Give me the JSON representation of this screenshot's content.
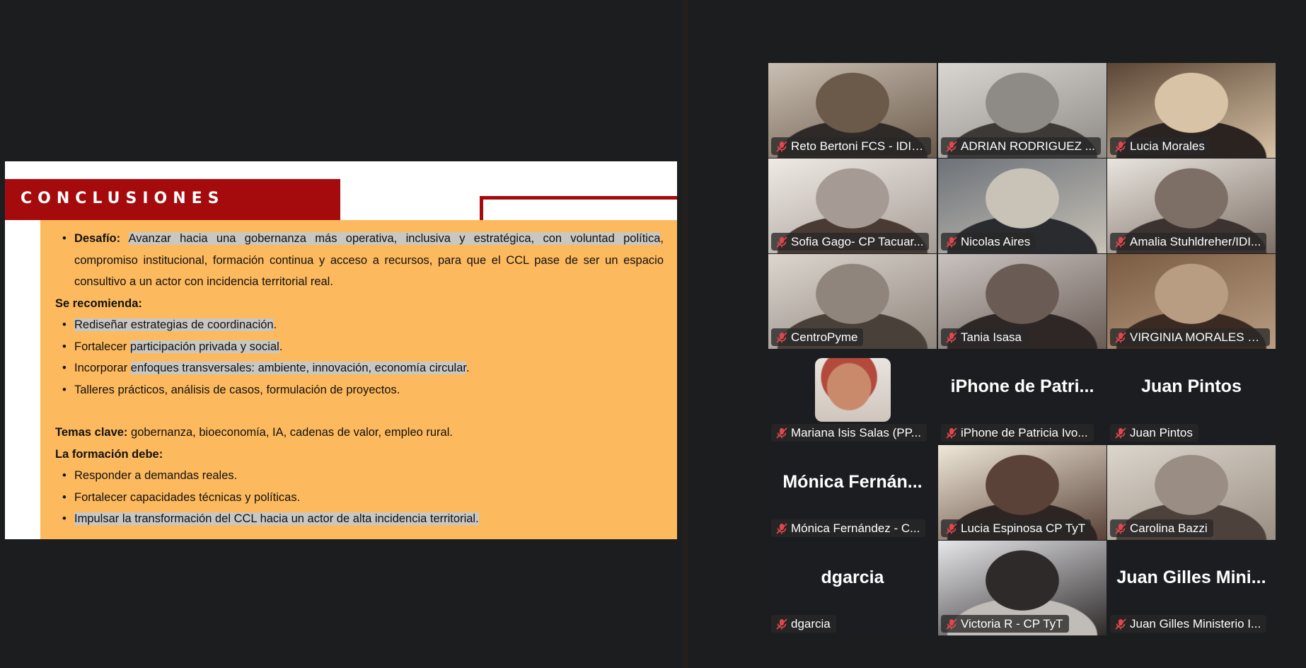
{
  "slide": {
    "title": "CONCLUSIONES",
    "desafio_label": "Desafío:",
    "desafio_hl": "Avanzar hacia una gobernanza más operativa, inclusiva y estratégica, con voluntad política",
    "desafio_rest": ", compromiso institucional, formación continua y acceso a recursos, para que el CCL pase de ser un espacio consultivo a un actor con incidencia territorial real.",
    "recomienda_heading": "Se recomienda:",
    "rec_1_hl": "Rediseñar estrategias de coordinación",
    "rec_1_end": ".",
    "rec_2_pre": "Fortalecer ",
    "rec_2_hl": "participación privada y social",
    "rec_2_end": ".",
    "rec_3_pre": "Incorporar ",
    "rec_3_hl": "enfoques transversales: ambiente, innovación, economía circular",
    "rec_3_end": ".",
    "rec_4": "Talleres prácticos, análisis de casos, formulación de proyectos.",
    "temas_label": "Temas clave:",
    "temas_text": " gobernanza, bioeconomía, IA, cadenas de valor, empleo rural.",
    "formacion_heading": "La formación debe:",
    "form_1": "Responder a demandas reales.",
    "form_2": "Fortalecer capacidades técnicas y políticas.",
    "form_3_hl": "Impulsar la transformación del CCL hacia un actor de alta incidencia territorial.",
    "bullet_char": "•"
  },
  "participants": [
    {
      "name": "Reto Bertoni FCS - IDIIS...",
      "video": true
    },
    {
      "name": "ADRIAN RODRIGUEZ ...",
      "video": true
    },
    {
      "name": "Lucia Morales",
      "video": true,
      "active_speaker": true
    },
    {
      "name": "Sofia Gago- CP Tacuar...",
      "video": true
    },
    {
      "name": "Nicolas Aires",
      "video": true
    },
    {
      "name": "Amalia Stuhldreher/IDI...",
      "video": true
    },
    {
      "name": "CentroPyme",
      "video": true
    },
    {
      "name": "Tania Isasa",
      "video": true
    },
    {
      "name": "VIRGINIA MORALES O...",
      "video": true
    },
    {
      "name": "Mariana Isis Salas  (PP...",
      "video": false,
      "avatar": true
    },
    {
      "name": "iPhone de Patricia Ivo...",
      "video": false,
      "big_name": "iPhone  de  Patri..."
    },
    {
      "name": "Juan Pintos",
      "video": false,
      "big_name": "Juan Pintos"
    },
    {
      "name": "Mónica Fernández - C...",
      "video": false,
      "big_name": "Mónica  Fernán..."
    },
    {
      "name": "Lucia Espinosa CP TyT",
      "video": true
    },
    {
      "name": "Carolina Bazzi",
      "video": true
    },
    {
      "name": "dgarcia",
      "video": false,
      "big_name": "dgarcia"
    },
    {
      "name": "Victoria R - CP TyT",
      "video": true
    },
    {
      "name": "Juan Gilles Ministerio I...",
      "video": false,
      "big_name": "Juan Gilles Mini..."
    }
  ],
  "colors": {
    "slide_accent": "#a50b0c",
    "slide_body": "#fdb95d",
    "highlight": "#c9c7c4",
    "active_border": "#2fd188",
    "mute_red": "#e0474f"
  },
  "icons": {
    "mute": "microphone-muted-icon"
  }
}
